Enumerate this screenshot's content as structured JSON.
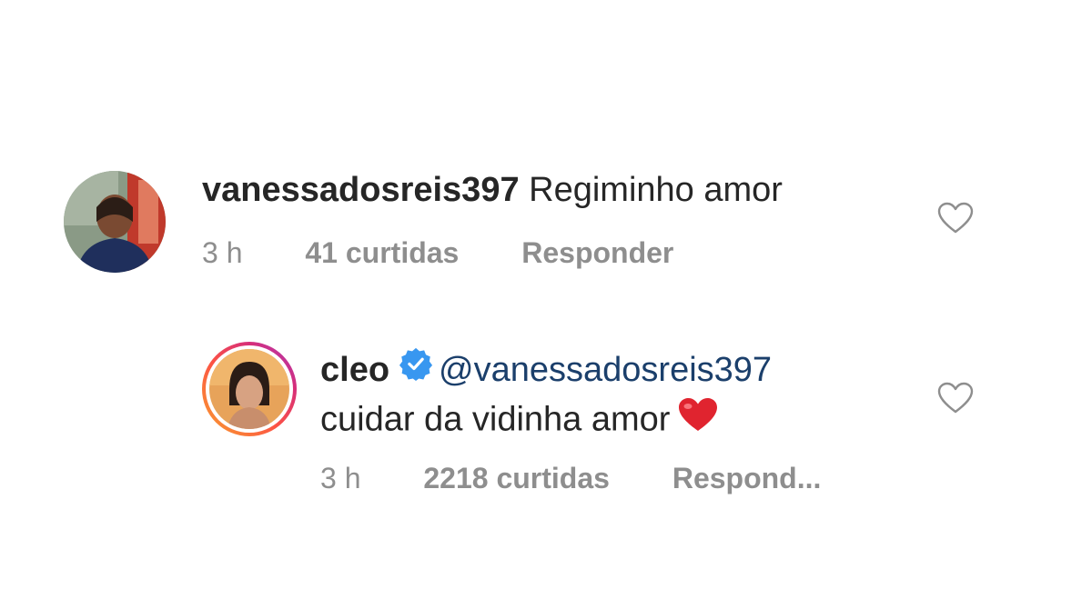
{
  "comments": [
    {
      "username": "vanessadosreis397",
      "text": "Regiminho amor",
      "time": "3 h",
      "likes": "41 curtidas",
      "reply": "Responder"
    }
  ],
  "reply_comment": {
    "username": "cleo",
    "verified": true,
    "mention": "@vanessadosreis397",
    "text": "cuidar da vidinha amor",
    "time": "3 h",
    "likes": "2218 curtidas",
    "reply": "Respond..."
  },
  "colors": {
    "username": "#262626",
    "meta": "#8e8e8e",
    "mention": "#1b3f6b",
    "verified": "#3897f0",
    "heart_emoji": "#e0242f"
  },
  "icons": {
    "like": "heart-outline-icon",
    "verified": "verified-badge-icon",
    "emoji": "red-heart-emoji"
  }
}
